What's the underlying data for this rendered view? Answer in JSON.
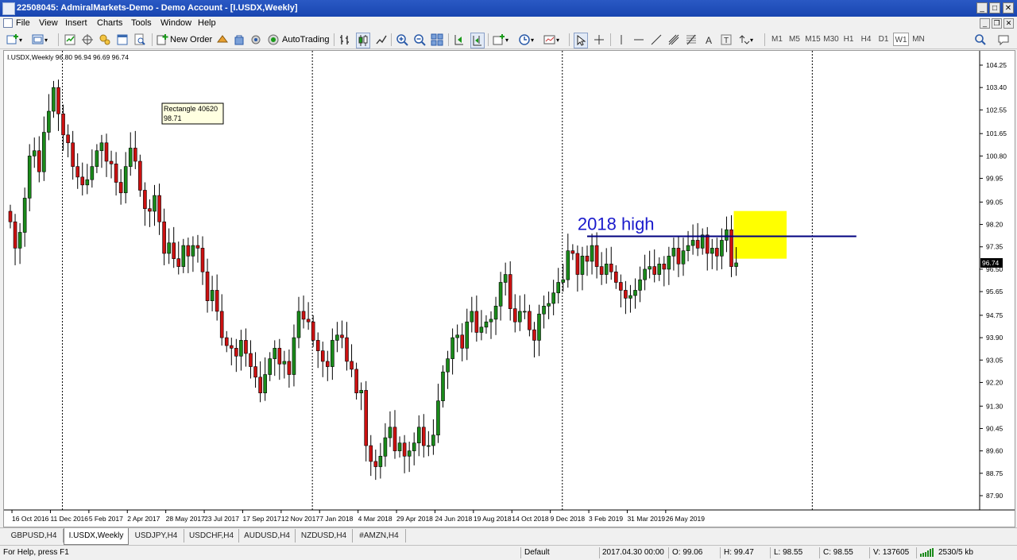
{
  "window": {
    "title": "22508045: AdmiralMarkets-Demo - Demo Account - [I.USDX,Weekly]",
    "minimize": "_",
    "maximize": "□",
    "close": "✕",
    "icon": "terminal-icon"
  },
  "menu": {
    "items": [
      "File",
      "View",
      "Insert",
      "Charts",
      "Tools",
      "Window",
      "Help"
    ],
    "mdi_buttons": [
      "_",
      "❐",
      "✕"
    ]
  },
  "toolbar": {
    "new_order_label": "New Order",
    "autotrading_label": "AutoTrading",
    "timeframes": [
      "M1",
      "M5",
      "M15",
      "M30",
      "H1",
      "H4",
      "D1",
      "W1",
      "MN"
    ],
    "active_timeframe": "W1"
  },
  "chart": {
    "header": "I.USDX,Weekly  96.80 96.94 96.69 96.74",
    "tooltip_name": "Rectangle 40620",
    "tooltip_value": "98.71",
    "annotation_text": "2018 high",
    "current_price_label": "96.74",
    "colors": {
      "up": "#1a8a1a",
      "down": "#cc1111",
      "wick": "#000000",
      "line": "#000080",
      "text": "#1a1acc",
      "highlight": "#ffff00",
      "price_tag": "#000000"
    }
  },
  "chart_data": {
    "type": "candlestick",
    "symbol": "I.USDX",
    "timeframe": "Weekly",
    "ylim": [
      87.9,
      104.25
    ],
    "y_ticks": [
      104.25,
      103.4,
      102.55,
      101.65,
      100.8,
      99.95,
      99.05,
      98.2,
      97.35,
      96.5,
      95.65,
      94.75,
      93.9,
      93.05,
      92.2,
      91.3,
      90.45,
      89.6,
      88.75,
      87.9
    ],
    "x_ticks": [
      "16 Oct 2016",
      "11 Dec 2016",
      "5 Feb 2017",
      "2 Apr 2017",
      "28 May 2017",
      "23 Jul 2017",
      "17 Sep 2017",
      "12 Nov 2017",
      "7 Jan 2018",
      "4 Mar 2018",
      "29 Apr 2018",
      "24 Jun 2018",
      "19 Aug 2018",
      "14 Oct 2018",
      "9 Dec 2018",
      "3 Feb 2019",
      "31 Mar 2019",
      "26 May 2019"
    ],
    "week_separators": [
      "1 Jan 2017",
      "1 Jan 2018",
      "1 Jan 2019",
      "1 Jan 2020"
    ],
    "horizontal_line": 97.75,
    "highlight_box": {
      "from": "17 Mar 2019",
      "to": "12 May 2019",
      "low": 96.9,
      "high": 98.71
    },
    "last_price": 96.74,
    "closes": [
      98.3,
      97.3,
      97.9,
      99.2,
      100.8,
      101.0,
      100.2,
      101.7,
      102.5,
      103.4,
      102.4,
      101.6,
      101.3,
      100.4,
      100.0,
      99.7,
      99.9,
      100.4,
      101.0,
      101.3,
      100.6,
      100.5,
      99.8,
      99.4,
      100.4,
      101.1,
      100.6,
      99.5,
      98.8,
      98.7,
      99.3,
      98.3,
      97.1,
      97.5,
      96.9,
      96.6,
      97.4,
      97.0,
      97.4,
      97.3,
      96.4,
      95.3,
      95.7,
      94.9,
      93.9,
      93.6,
      93.5,
      93.2,
      93.8,
      93.3,
      92.8,
      92.4,
      91.8,
      92.5,
      93.1,
      93.5,
      92.9,
      93.0,
      92.5,
      93.9,
      94.9,
      94.6,
      94.5,
      93.8,
      93.4,
      93.0,
      92.8,
      93.8,
      94.0,
      93.9,
      93.0,
      92.7,
      91.8,
      91.9,
      89.8,
      89.2,
      89.0,
      89.4,
      90.1,
      90.5,
      89.6,
      89.9,
      89.4,
      89.6,
      89.9,
      90.5,
      89.8,
      89.8,
      90.2,
      91.5,
      92.6,
      93.1,
      93.9,
      94.0,
      93.5,
      94.5,
      94.9,
      94.1,
      94.3,
      94.5,
      94.6,
      95.1,
      96.0,
      96.3,
      95.0,
      94.5,
      94.9,
      94.9,
      94.2,
      93.8,
      94.8,
      95.1,
      95.2,
      95.6,
      96.0,
      96.1,
      97.2,
      97.1,
      96.3,
      97.0,
      96.8,
      97.4,
      96.6,
      96.3,
      96.7,
      96.4,
      96.0,
      95.7,
      95.4,
      95.5,
      95.7,
      96.1,
      96.5,
      96.6,
      96.3,
      96.7,
      96.5,
      97.0,
      97.3,
      96.7,
      97.2,
      97.4,
      97.6,
      97.3,
      97.8,
      97.1,
      97.3,
      97.0,
      97.6,
      98.0,
      96.6,
      96.74
    ]
  },
  "tabs": [
    "GBPUSD,H4",
    "I.USDX,Weekly",
    "USDJPY,H4",
    "USDCHF,H4",
    "AUDUSD,H4",
    "NZDUSD,H4",
    "#AMZN,H4"
  ],
  "active_tab": "I.USDX,Weekly",
  "status": {
    "help": "For Help, press F1",
    "profile": "Default",
    "datetime": "2017.04.30 00:00",
    "open": "O: 99.06",
    "high": "H: 99.47",
    "low": "L: 98.55",
    "close": "C: 98.55",
    "volume": "V: 137605",
    "traffic": "2530/5 kb"
  }
}
